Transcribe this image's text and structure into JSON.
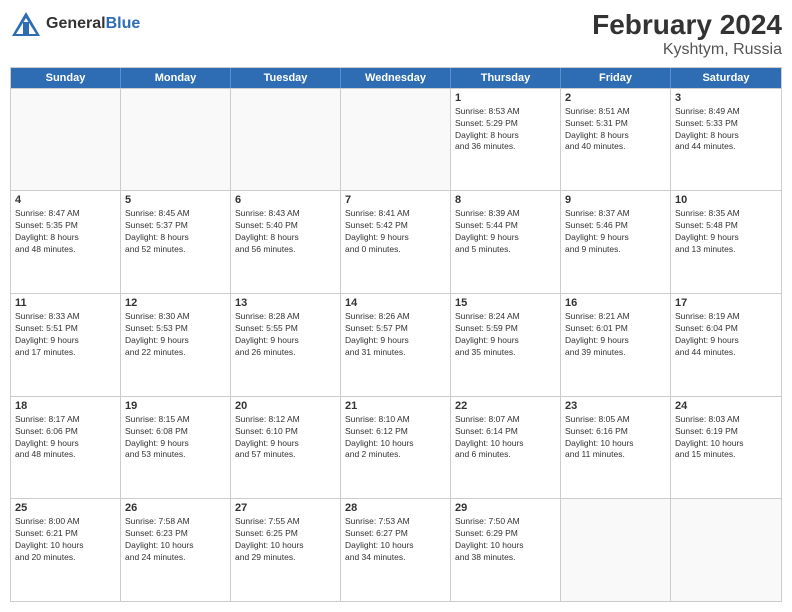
{
  "header": {
    "logo_general": "General",
    "logo_blue": "Blue",
    "title": "February 2024",
    "subtitle": "Kyshtym, Russia"
  },
  "days_of_week": [
    "Sunday",
    "Monday",
    "Tuesday",
    "Wednesday",
    "Thursday",
    "Friday",
    "Saturday"
  ],
  "weeks": [
    [
      {
        "day": "",
        "empty": true
      },
      {
        "day": "",
        "empty": true
      },
      {
        "day": "",
        "empty": true
      },
      {
        "day": "",
        "empty": true
      },
      {
        "day": "1",
        "info": "Sunrise: 8:53 AM\nSunset: 5:29 PM\nDaylight: 8 hours\nand 36 minutes."
      },
      {
        "day": "2",
        "info": "Sunrise: 8:51 AM\nSunset: 5:31 PM\nDaylight: 8 hours\nand 40 minutes."
      },
      {
        "day": "3",
        "info": "Sunrise: 8:49 AM\nSunset: 5:33 PM\nDaylight: 8 hours\nand 44 minutes."
      }
    ],
    [
      {
        "day": "4",
        "info": "Sunrise: 8:47 AM\nSunset: 5:35 PM\nDaylight: 8 hours\nand 48 minutes."
      },
      {
        "day": "5",
        "info": "Sunrise: 8:45 AM\nSunset: 5:37 PM\nDaylight: 8 hours\nand 52 minutes."
      },
      {
        "day": "6",
        "info": "Sunrise: 8:43 AM\nSunset: 5:40 PM\nDaylight: 8 hours\nand 56 minutes."
      },
      {
        "day": "7",
        "info": "Sunrise: 8:41 AM\nSunset: 5:42 PM\nDaylight: 9 hours\nand 0 minutes."
      },
      {
        "day": "8",
        "info": "Sunrise: 8:39 AM\nSunset: 5:44 PM\nDaylight: 9 hours\nand 5 minutes."
      },
      {
        "day": "9",
        "info": "Sunrise: 8:37 AM\nSunset: 5:46 PM\nDaylight: 9 hours\nand 9 minutes."
      },
      {
        "day": "10",
        "info": "Sunrise: 8:35 AM\nSunset: 5:48 PM\nDaylight: 9 hours\nand 13 minutes."
      }
    ],
    [
      {
        "day": "11",
        "info": "Sunrise: 8:33 AM\nSunset: 5:51 PM\nDaylight: 9 hours\nand 17 minutes."
      },
      {
        "day": "12",
        "info": "Sunrise: 8:30 AM\nSunset: 5:53 PM\nDaylight: 9 hours\nand 22 minutes."
      },
      {
        "day": "13",
        "info": "Sunrise: 8:28 AM\nSunset: 5:55 PM\nDaylight: 9 hours\nand 26 minutes."
      },
      {
        "day": "14",
        "info": "Sunrise: 8:26 AM\nSunset: 5:57 PM\nDaylight: 9 hours\nand 31 minutes."
      },
      {
        "day": "15",
        "info": "Sunrise: 8:24 AM\nSunset: 5:59 PM\nDaylight: 9 hours\nand 35 minutes."
      },
      {
        "day": "16",
        "info": "Sunrise: 8:21 AM\nSunset: 6:01 PM\nDaylight: 9 hours\nand 39 minutes."
      },
      {
        "day": "17",
        "info": "Sunrise: 8:19 AM\nSunset: 6:04 PM\nDaylight: 9 hours\nand 44 minutes."
      }
    ],
    [
      {
        "day": "18",
        "info": "Sunrise: 8:17 AM\nSunset: 6:06 PM\nDaylight: 9 hours\nand 48 minutes."
      },
      {
        "day": "19",
        "info": "Sunrise: 8:15 AM\nSunset: 6:08 PM\nDaylight: 9 hours\nand 53 minutes."
      },
      {
        "day": "20",
        "info": "Sunrise: 8:12 AM\nSunset: 6:10 PM\nDaylight: 9 hours\nand 57 minutes."
      },
      {
        "day": "21",
        "info": "Sunrise: 8:10 AM\nSunset: 6:12 PM\nDaylight: 10 hours\nand 2 minutes."
      },
      {
        "day": "22",
        "info": "Sunrise: 8:07 AM\nSunset: 6:14 PM\nDaylight: 10 hours\nand 6 minutes."
      },
      {
        "day": "23",
        "info": "Sunrise: 8:05 AM\nSunset: 6:16 PM\nDaylight: 10 hours\nand 11 minutes."
      },
      {
        "day": "24",
        "info": "Sunrise: 8:03 AM\nSunset: 6:19 PM\nDaylight: 10 hours\nand 15 minutes."
      }
    ],
    [
      {
        "day": "25",
        "info": "Sunrise: 8:00 AM\nSunset: 6:21 PM\nDaylight: 10 hours\nand 20 minutes."
      },
      {
        "day": "26",
        "info": "Sunrise: 7:58 AM\nSunset: 6:23 PM\nDaylight: 10 hours\nand 24 minutes."
      },
      {
        "day": "27",
        "info": "Sunrise: 7:55 AM\nSunset: 6:25 PM\nDaylight: 10 hours\nand 29 minutes."
      },
      {
        "day": "28",
        "info": "Sunrise: 7:53 AM\nSunset: 6:27 PM\nDaylight: 10 hours\nand 34 minutes."
      },
      {
        "day": "29",
        "info": "Sunrise: 7:50 AM\nSunset: 6:29 PM\nDaylight: 10 hours\nand 38 minutes."
      },
      {
        "day": "",
        "empty": true
      },
      {
        "day": "",
        "empty": true
      }
    ]
  ]
}
